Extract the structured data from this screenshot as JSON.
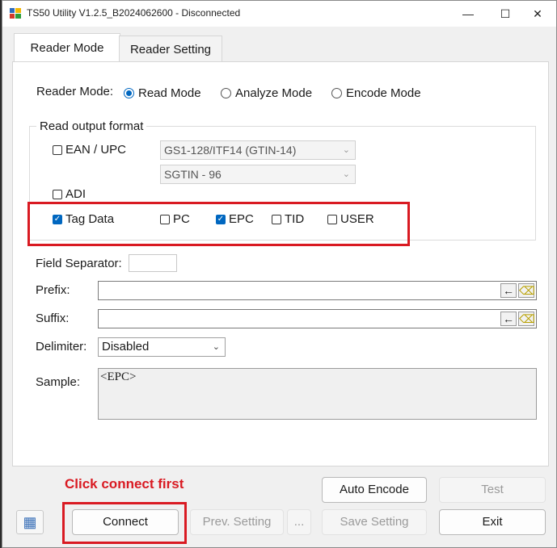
{
  "window": {
    "title": "TS50 Utility V1.2.5_B2024062600 - Disconnected",
    "controls": {
      "minimize": "—",
      "maximize": "☐",
      "close": "✕"
    }
  },
  "tabs": [
    {
      "label": "Reader Mode",
      "selected": true
    },
    {
      "label": "Reader Setting",
      "selected": false
    }
  ],
  "reader_mode": {
    "label": "Reader Mode:",
    "options": [
      {
        "label": "Read Mode",
        "selected": true
      },
      {
        "label": "Analyze Mode",
        "selected": false
      },
      {
        "label": "Encode Mode",
        "selected": false
      }
    ]
  },
  "read_output": {
    "group_label": "Read output format",
    "ean_upc": {
      "label": "EAN / UPC",
      "checked": false
    },
    "ean_combo": "GS1-128/ITF14 (GTIN-14)",
    "sgtin_combo": "SGTIN - 96",
    "adi": {
      "label": "ADI",
      "checked": false
    },
    "tag_data": {
      "label": "Tag Data",
      "checked": true
    },
    "pc": {
      "label": "PC",
      "checked": false
    },
    "epc": {
      "label": "EPC",
      "checked": true
    },
    "tid": {
      "label": "TID",
      "checked": false
    },
    "user": {
      "label": "USER",
      "checked": false
    }
  },
  "fields": {
    "field_separator_label": "Field Separator:",
    "field_separator_value": "",
    "prefix_label": "Prefix:",
    "prefix_value": "",
    "suffix_label": "Suffix:",
    "suffix_value": "",
    "delimiter_label": "Delimiter:",
    "delimiter_value": "Disabled",
    "sample_label": "Sample:",
    "sample_value": "<EPC>"
  },
  "icons": {
    "backspace": "←",
    "eraser": "⌫",
    "dropdown": "⌄",
    "app": "▦",
    "check": "✓"
  },
  "buttons": {
    "auto_encode": "Auto Encode",
    "test": "Test",
    "connect": "Connect",
    "prev_setting": "Prev. Setting",
    "ellipsis": "...",
    "save_setting": "Save Setting",
    "exit": "Exit"
  },
  "annotation": {
    "text": "Click connect first",
    "color": "#d91a22"
  },
  "colors": {
    "accent": "#0067c0",
    "highlight": "#d91a22"
  }
}
